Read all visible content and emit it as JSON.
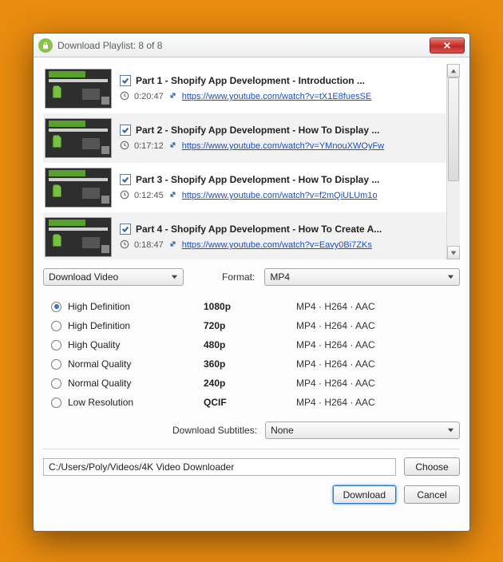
{
  "titlebar": {
    "title": "Download Playlist: 8 of 8"
  },
  "playlist": {
    "items": [
      {
        "title": "Part 1 -  Shopify App Development -  Introduction ...",
        "duration": "0:20:47",
        "url": "https://www.youtube.com/watch?v=tX1E8fuesSE",
        "checked": true
      },
      {
        "title": "Part 2 - Shopify App Development - How To Display ...",
        "duration": "0:17:12",
        "url": "https://www.youtube.com/watch?v=YMnouXWOyFw",
        "checked": true
      },
      {
        "title": "Part 3 - Shopify App Development - How To Display ...",
        "duration": "0:12:45",
        "url": "https://www.youtube.com/watch?v=f2mQiULUm1o",
        "checked": true
      },
      {
        "title": "Part 4 - Shopify App Development - How To Create A...",
        "duration": "0:18:47",
        "url": "https://www.youtube.com/watch?v=Eavy0Bi7ZKs",
        "checked": true
      }
    ]
  },
  "controls": {
    "mode_label": "Download Video",
    "format_caption": "Format:",
    "format_value": "MP4",
    "subtitles_caption": "Download Subtitles:",
    "subtitles_value": "None"
  },
  "quality": {
    "selected_index": 0,
    "rows": [
      {
        "label": "High Definition",
        "res": "1080p",
        "fmt": "MP4 · H264 · AAC"
      },
      {
        "label": "High Definition",
        "res": "720p",
        "fmt": "MP4 · H264 · AAC"
      },
      {
        "label": "High Quality",
        "res": "480p",
        "fmt": "MP4 · H264 · AAC"
      },
      {
        "label": "Normal Quality",
        "res": "360p",
        "fmt": "MP4 · H264 · AAC"
      },
      {
        "label": "Normal Quality",
        "res": "240p",
        "fmt": "MP4 · H264 · AAC"
      },
      {
        "label": "Low Resolution",
        "res": "QCIF",
        "fmt": "MP4 · H264 · AAC"
      }
    ]
  },
  "path": {
    "value": "C:/Users/Poly/Videos/4K Video Downloader"
  },
  "buttons": {
    "choose": "Choose",
    "download": "Download",
    "cancel": "Cancel"
  }
}
